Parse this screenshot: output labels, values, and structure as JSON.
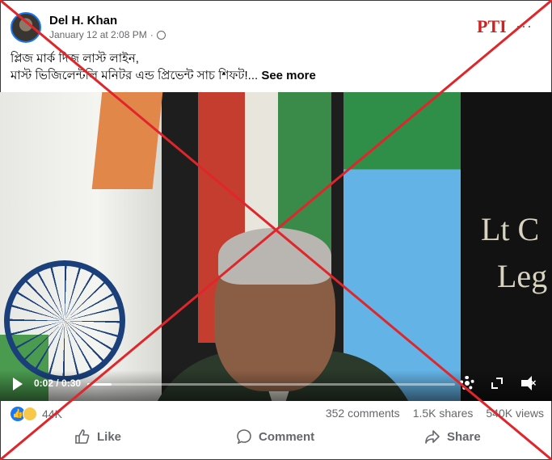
{
  "post": {
    "author": "Del H. Khan",
    "timestamp": "January 12 at 2:08 PM",
    "privacy_icon": "globe-icon",
    "more_icon": "more-dots-icon",
    "caption_line1": "প্লিজ মার্ক দিজ লাস্ট লাইন,",
    "caption_line2": "মাস্ট ভিজিলেন্টলি মনিটর এন্ড প্রিভেন্ট সাচ শিফট!...",
    "see_more": "See more"
  },
  "video": {
    "watermark": "PTI",
    "banner_text": "Lt C\n  Leg",
    "time_display": "0:02 / 0:30",
    "progress_fraction": 0.067,
    "icons": [
      "play-icon",
      "gear-icon",
      "expand-icon",
      "volume-muted-icon"
    ]
  },
  "stats": {
    "reaction_count": "44K",
    "comments": "352 comments",
    "shares": "1.5K shares",
    "views": "540K views"
  },
  "actions": {
    "like": "Like",
    "comment": "Comment",
    "share": "Share"
  },
  "colors": {
    "fb_blue": "#1877f2",
    "secondary_text": "#65676b",
    "cross_red": "#e0252b"
  }
}
